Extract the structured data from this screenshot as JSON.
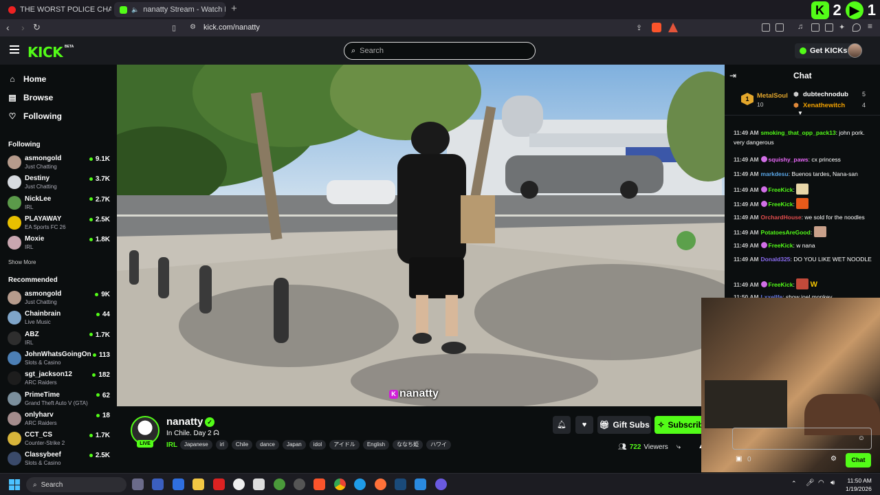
{
  "browser": {
    "tabs": [
      {
        "title": "THE WORST POLICE CHASE I'VE EVE"
      },
      {
        "title": "nanatty Stream - Watch Live o"
      }
    ],
    "url": "kick.com/nanatty",
    "ext_count_1": "2",
    "ext_count_2": "1"
  },
  "header": {
    "logo": "KICK",
    "beta": "BETA",
    "search_placeholder": "Search",
    "get_kicks": "Get KICKs"
  },
  "sidebar": {
    "nav": [
      {
        "label": "Home",
        "icon": "home-icon"
      },
      {
        "label": "Browse",
        "icon": "browse-icon"
      },
      {
        "label": "Following",
        "icon": "heart-icon"
      }
    ],
    "following_title": "Following",
    "following": [
      {
        "name": "asmongold",
        "category": "Just Chatting",
        "viewers": "9.1K",
        "color": "#b69b8c"
      },
      {
        "name": "Destiny",
        "category": "Just Chatting",
        "viewers": "3.7K",
        "color": "#d7dbe0"
      },
      {
        "name": "NickLee",
        "category": "IRL",
        "viewers": "2.7K",
        "color": "#5b9a4a"
      },
      {
        "name": "PLAYAWAY",
        "category": "EA Sports FC 26",
        "viewers": "2.5K",
        "color": "#e8c000"
      },
      {
        "name": "Moxie",
        "category": "IRL",
        "viewers": "1.8K",
        "color": "#c9a6b0"
      }
    ],
    "show_more": "Show More",
    "recommended_title": "Recommended",
    "recommended": [
      {
        "name": "asmongold",
        "category": "Just Chatting",
        "viewers": "9K",
        "color": "#b69b8c"
      },
      {
        "name": "Chainbrain",
        "category": "Live Music",
        "viewers": "44",
        "color": "#7fa5c9"
      },
      {
        "name": "ABZ",
        "category": "IRL",
        "viewers": "1.7K",
        "color": "#2e2e2e"
      },
      {
        "name": "JohnWhatsGoingOn",
        "category": "Slots & Casino",
        "viewers": "113",
        "color": "#4c7fb5"
      },
      {
        "name": "sgt_jackson12",
        "category": "ARC Raiders",
        "viewers": "182",
        "color": "#1d1d1d"
      },
      {
        "name": "PrimeTime",
        "category": "Grand Theft Auto V (GTA)",
        "viewers": "62",
        "color": "#7b8f9c"
      },
      {
        "name": "onlyharv",
        "category": "ARC Raiders",
        "viewers": "18",
        "color": "#a48c8c"
      },
      {
        "name": "CCT_CS",
        "category": "Counter-Strike 2",
        "viewers": "1.7K",
        "color": "#d7b43a"
      },
      {
        "name": "Classybeef",
        "category": "Slots & Casino",
        "viewers": "2.5K",
        "color": "#3a4a6a"
      }
    ]
  },
  "video": {
    "watermark": "nanatty"
  },
  "stream": {
    "name": "nanatty",
    "live": "LIVE",
    "title": "In Chile. Day 2",
    "category": "IRL",
    "tags": [
      "Japanese",
      "irl",
      "Chile",
      "dance",
      "Japan",
      "idol",
      "アイドル",
      "English",
      "ななち姫",
      "ハワイ"
    ],
    "gift_subs": "Gift Subs",
    "subscribe": "Subscribe",
    "viewers_count": "722",
    "viewers_label": "Viewers"
  },
  "chat": {
    "title": "Chat",
    "gifters": [
      {
        "name": "MetalSoul",
        "count": "10"
      },
      {
        "name": "dubtechnodub",
        "count": "5"
      },
      {
        "name": "Xenathewitch",
        "count": "4"
      }
    ],
    "messages": [
      {
        "time": "11:49 AM",
        "user": "smoking_that_opp_pack13",
        "color": "#53fc18",
        "text": "john pork. very dangerous"
      },
      {
        "time": "11:49 AM",
        "user": "squishy_paws",
        "color": "#e667f5",
        "text": "cx princess"
      },
      {
        "time": "11:49 AM",
        "user": "markdesu",
        "color": "#5aa7e8",
        "text": "Buenos tardes, Nana-san"
      },
      {
        "time": "11:49 AM",
        "user": "FreeKick",
        "color": "#53fc18",
        "text": ""
      },
      {
        "time": "11:49 AM",
        "user": "FreeKick",
        "color": "#53fc18",
        "text": ""
      },
      {
        "time": "11:49 AM",
        "user": "OrchardHouse",
        "color": "#e04c4c",
        "text": "we sold for the noodles"
      },
      {
        "time": "11:49 AM",
        "user": "PotatoesAreGood",
        "color": "#53fc18",
        "text": ""
      },
      {
        "time": "11:49 AM",
        "user": "FreeKick",
        "color": "#53fc18",
        "text": "w nana"
      },
      {
        "time": "11:49 AM",
        "user": "Donald325",
        "color": "#8a6cf0",
        "text": "DO YOU LIKE WET NOODLE"
      },
      {
        "time": "11:49 AM",
        "user": "FreeKick",
        "color": "#53fc18",
        "text": ""
      },
      {
        "time": "11:50 AM",
        "user": "Lxxellfe",
        "color": "#6a7be8",
        "text": "show joel monkey"
      }
    ],
    "kicks_count": "0",
    "chat_button": "Chat"
  },
  "taskbar": {
    "search": "Search",
    "time": "11:50 AM",
    "date": "1/19/2026"
  }
}
